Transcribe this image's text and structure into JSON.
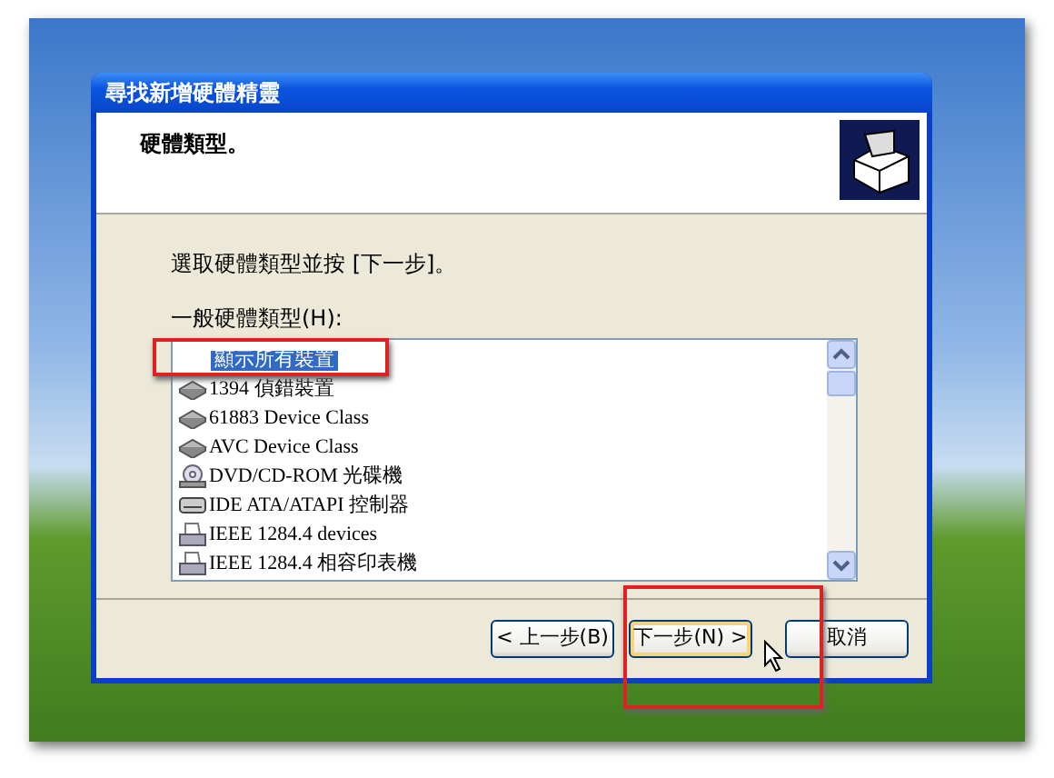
{
  "window": {
    "title": "尋找新增硬體精靈"
  },
  "header": {
    "title": "硬體類型。"
  },
  "instruction": "選取硬體類型並按 [下一步]。",
  "list": {
    "label": "一般硬體類型(H):",
    "items": [
      {
        "label": "顯示所有裝置",
        "kind": "none",
        "selected": true
      },
      {
        "label": "1394 偵錯裝置",
        "kind": "device",
        "selected": false
      },
      {
        "label": "61883 Device Class",
        "kind": "device",
        "selected": false
      },
      {
        "label": "AVC Device Class",
        "kind": "device",
        "selected": false
      },
      {
        "label": "DVD/CD-ROM 光碟機",
        "kind": "disc",
        "selected": false
      },
      {
        "label": "IDE ATA/ATAPI 控制器",
        "kind": "controller",
        "selected": false
      },
      {
        "label": "IEEE 1284.4 devices",
        "kind": "printer",
        "selected": false
      },
      {
        "label": "IEEE 1284.4 相容印表機",
        "kind": "printer",
        "selected": false
      }
    ]
  },
  "buttons": [
    {
      "label": "< 上一步(B)",
      "default": false
    },
    {
      "label": "下一步(N) >",
      "default": true
    },
    {
      "label": "取消",
      "default": false
    }
  ]
}
